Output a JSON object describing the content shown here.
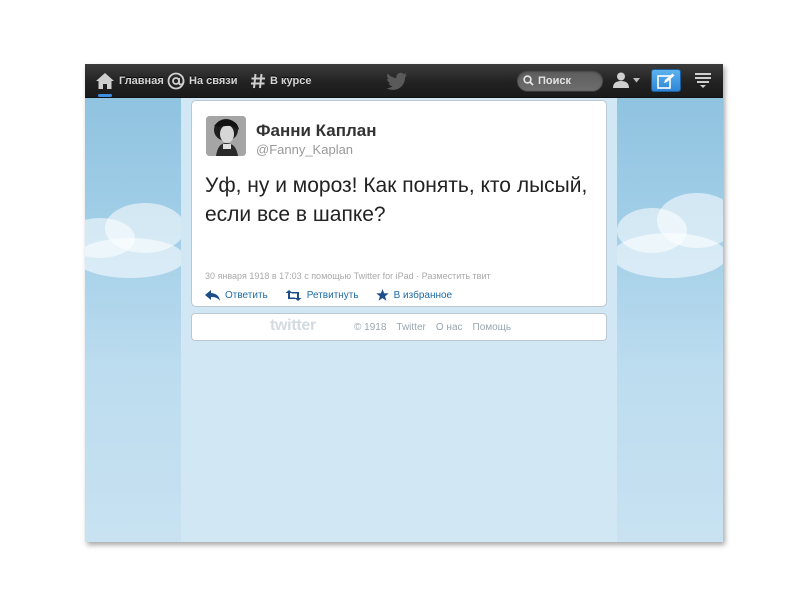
{
  "nav": {
    "home_label": "Главная",
    "connect_label": "На связи",
    "discover_label": "В курсе"
  },
  "search": {
    "placeholder": "Поиск"
  },
  "tweet": {
    "name": "Фанни Каплан",
    "handle": "@Fanny_Kaplan",
    "text": "Уф, ну и мороз! Как понять, кто лысый, если все в шапке?",
    "date": "30 января 1918",
    "time": "в 17:03",
    "via": "с помощью Twitter for iPad",
    "separator": "·",
    "embed_label": "Разместить твит",
    "reply_label": "Ответить",
    "retweet_label": "Ретвитнуть",
    "favorite_label": "В избранное"
  },
  "footer": {
    "logo": "twitter",
    "copyright": "© 1918",
    "link_twitter": "Twitter",
    "link_about": "О нас",
    "link_help": "Помощь"
  },
  "colors": {
    "topbar": "#222222",
    "accent": "#2d86d6",
    "link": "#1c6aa8",
    "sky": "#9fcde6"
  }
}
